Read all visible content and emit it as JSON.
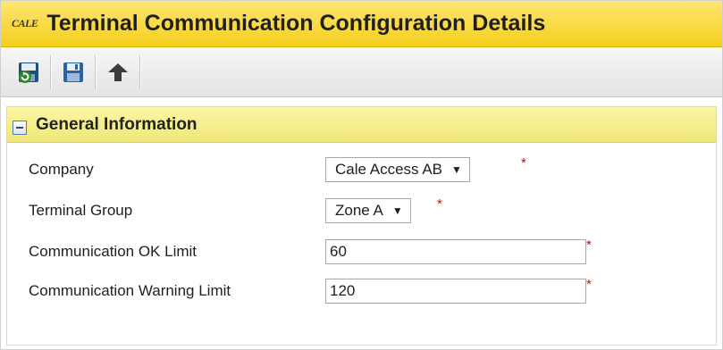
{
  "header": {
    "logo_text": "CALE",
    "title": "Terminal Communication Configuration Details"
  },
  "toolbar": {
    "items": [
      {
        "icon": "save-and-refresh-icon"
      },
      {
        "icon": "save-icon"
      },
      {
        "icon": "up-arrow-icon"
      }
    ]
  },
  "section": {
    "title": "General Information",
    "fields": {
      "company": {
        "label": "Company",
        "value": "Cale Access AB",
        "arrow": "▼",
        "required": "*"
      },
      "terminal_group": {
        "label": "Terminal Group",
        "value": "Zone A",
        "arrow": "▼",
        "required": "*"
      },
      "ok_limit": {
        "label": "Communication OK Limit",
        "value": "60",
        "required": "*"
      },
      "warning_limit": {
        "label": "Communication Warning Limit",
        "value": "120",
        "required": "*"
      }
    }
  },
  "colors": {
    "title_bar": "#f3cf1c",
    "section_header": "#efe778",
    "required": "#e00000"
  }
}
